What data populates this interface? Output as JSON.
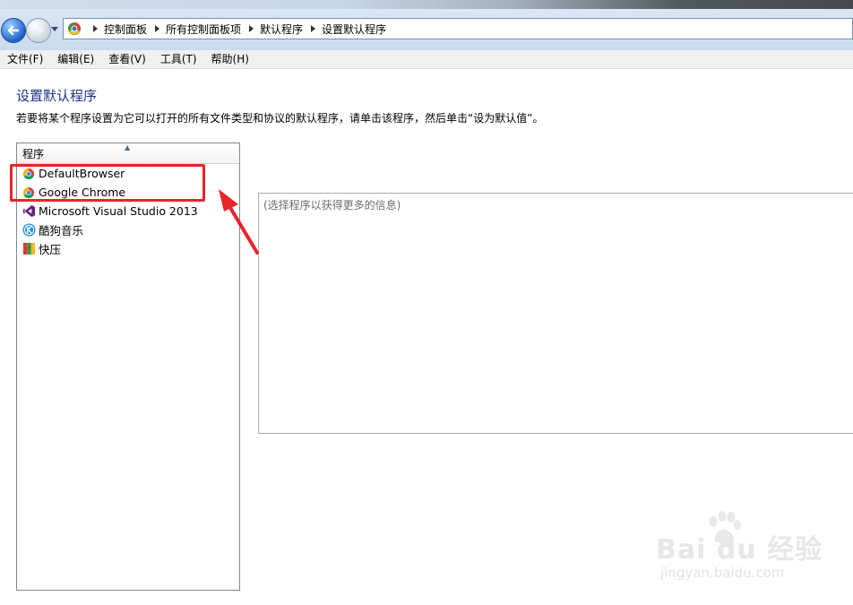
{
  "address": {
    "breadcrumbs": [
      "控制面板",
      "所有控制面板项",
      "默认程序",
      "设置默认程序"
    ]
  },
  "menu": {
    "items": [
      "文件(F)",
      "编辑(E)",
      "查看(V)",
      "工具(T)",
      "帮助(H)"
    ]
  },
  "page": {
    "title": "设置默认程序",
    "description": "若要将某个程序设置为它可以打开的所有文件类型和协议的默认程序，请单击该程序，然后单击“设为默认值”。"
  },
  "programs": {
    "header": "程序",
    "items": [
      {
        "label": "DefaultBrowser",
        "icon": "chrome-icon"
      },
      {
        "label": "Google Chrome",
        "icon": "chrome-icon"
      },
      {
        "label": "Microsoft Visual Studio 2013",
        "icon": "visual-studio-icon"
      },
      {
        "label": "酷狗音乐",
        "icon": "kugou-icon"
      },
      {
        "label": "快压",
        "icon": "kuaiya-icon"
      }
    ]
  },
  "info": {
    "placeholder": "(选择程序以获得更多的信息)"
  },
  "watermark": {
    "main": "Bai du 经验",
    "sub": "jingyan.baidu.com"
  },
  "colors": {
    "highlight": "#e8252b",
    "title": "#1e3287"
  }
}
